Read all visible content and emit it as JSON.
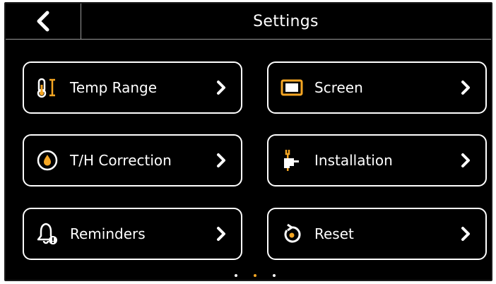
{
  "header": {
    "title": "Settings"
  },
  "tiles": [
    {
      "label": "Temp Range",
      "icon": "thermometer-range-icon"
    },
    {
      "label": "Screen",
      "icon": "screen-icon"
    },
    {
      "label": "T/H Correction",
      "icon": "droplet-correction-icon"
    },
    {
      "label": "Installation",
      "icon": "wrench-hand-icon"
    },
    {
      "label": "Reminders",
      "icon": "bell-alert-icon"
    },
    {
      "label": "Reset",
      "icon": "reset-icon"
    }
  ],
  "pagination": {
    "pages": 3,
    "current": 2
  },
  "colors": {
    "background": "#000000",
    "text": "#ffffff",
    "accent": "#f5a623",
    "divider": "#9a9a9a"
  }
}
